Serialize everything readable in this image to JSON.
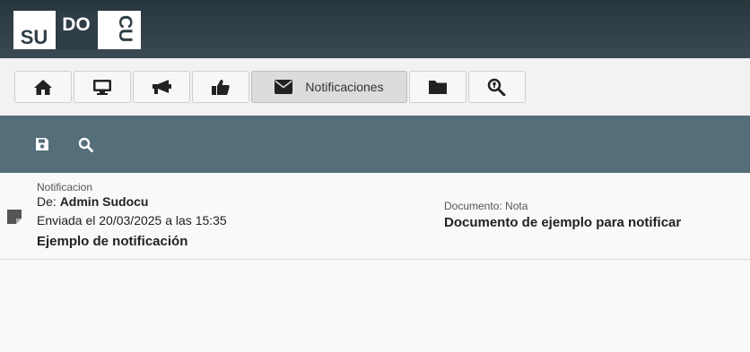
{
  "logo": {
    "line1": "SU",
    "line2": "DO",
    "line3": "CU"
  },
  "nav": {
    "buttons": [
      {
        "icon": "home-icon"
      },
      {
        "icon": "monitor-icon"
      },
      {
        "icon": "megaphone-icon"
      },
      {
        "icon": "thumbs-up-icon"
      },
      {
        "icon": "envelope-icon",
        "label": "Notificaciones",
        "active": true
      },
      {
        "icon": "folder-icon"
      },
      {
        "icon": "search-key-icon"
      }
    ]
  },
  "toolbar": {
    "icons": [
      "save-icon",
      "search-icon"
    ]
  },
  "notification": {
    "type_label": "Notificacion",
    "from_prefix": "De:",
    "from_name": "Admin Sudocu",
    "sent": "Enviada el 20/03/2025 a las 15:35",
    "title": "Ejemplo de notificación",
    "doc_type": "Documento: Nota",
    "doc_title": "Documento de ejemplo para notificar"
  },
  "colors": {
    "topbar": "#2f3e46",
    "toolbar": "#546e7a",
    "nav_bg": "#f2f2f2"
  }
}
